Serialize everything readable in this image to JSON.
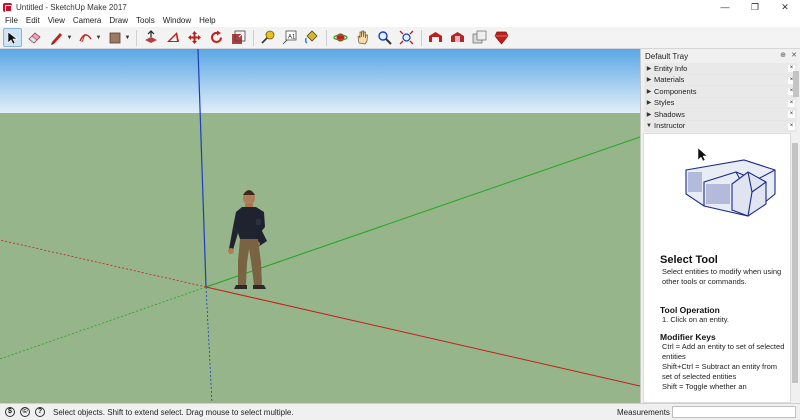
{
  "window": {
    "title": "Untitled - SketchUp Make 2017",
    "controls": {
      "minimize": "—",
      "maximize": "❐",
      "close": "✕"
    }
  },
  "menu": {
    "items": [
      "File",
      "Edit",
      "View",
      "Camera",
      "Draw",
      "Tools",
      "Window",
      "Help"
    ]
  },
  "toolbar": {
    "tools": [
      {
        "name": "select-tool",
        "icon": "arrow-cursor-icon",
        "active": true
      },
      {
        "name": "eraser-tool",
        "icon": "eraser-icon"
      },
      {
        "name": "line-tool",
        "icon": "pencil-icon",
        "has_menu": true
      },
      {
        "name": "arc-tool",
        "icon": "arc-icon",
        "has_menu": true
      },
      {
        "name": "shape-tool",
        "icon": "rectangle-icon",
        "has_menu": true
      },
      {
        "name": "push-pull-tool",
        "icon": "push-pull-icon"
      },
      {
        "name": "offset-tool",
        "icon": "offset-icon"
      },
      {
        "name": "move-tool",
        "icon": "move-icon"
      },
      {
        "name": "rotate-tool",
        "icon": "rotate-icon"
      },
      {
        "name": "scale-tool",
        "icon": "scale-icon"
      },
      {
        "name": "tape-measure-tool",
        "icon": "tape-measure-icon"
      },
      {
        "name": "text-tool",
        "icon": "text-icon"
      },
      {
        "name": "paint-bucket-tool",
        "icon": "paint-bucket-icon"
      },
      {
        "name": "orbit-tool",
        "icon": "orbit-icon"
      },
      {
        "name": "pan-tool",
        "icon": "hand-icon"
      },
      {
        "name": "zoom-tool",
        "icon": "magnifier-icon"
      },
      {
        "name": "zoom-extents-tool",
        "icon": "zoom-extents-icon"
      },
      {
        "name": "3d-warehouse",
        "icon": "warehouse-icon"
      },
      {
        "name": "extension-warehouse",
        "icon": "extension-icon"
      },
      {
        "name": "layout-send",
        "icon": "layout-icon"
      },
      {
        "name": "extension-manager",
        "icon": "ruby-icon"
      }
    ]
  },
  "tray": {
    "title": "Default Tray",
    "pin": "⊕",
    "close": "✕",
    "panels": [
      {
        "label": "Entity Info",
        "expanded": false
      },
      {
        "label": "Materials",
        "expanded": false
      },
      {
        "label": "Components",
        "expanded": false
      },
      {
        "label": "Styles",
        "expanded": false
      },
      {
        "label": "Shadows",
        "expanded": false
      },
      {
        "label": "Instructor",
        "expanded": true
      }
    ],
    "collapsed_glyph": "▶",
    "expanded_glyph": "▼",
    "panel_close": "×"
  },
  "instructor": {
    "title": "Select Tool",
    "description": "Select entities to modify when using other tools or commands.",
    "operation_heading": "Tool Operation",
    "operation_text": "1. Click on an entity.",
    "modifier_heading": "Modifier Keys",
    "modifier_text": "Ctrl = Add an entity to set of selected entities\nShift+Ctrl = Subtract an entity from set of selected entities\nShift = Toggle whether an"
  },
  "status": {
    "message": "Select objects. Shift to extend select. Drag mouse to select multiple.",
    "measurements_label": "Measurements",
    "measurements_value": ""
  },
  "colors": {
    "sky_top": "#5aa7e6",
    "sky_bottom": "#e2eef8",
    "ground": "#97b58a",
    "axis_red": "#c0201c",
    "axis_green": "#1fa61f",
    "axis_blue": "#1c3fb8"
  }
}
